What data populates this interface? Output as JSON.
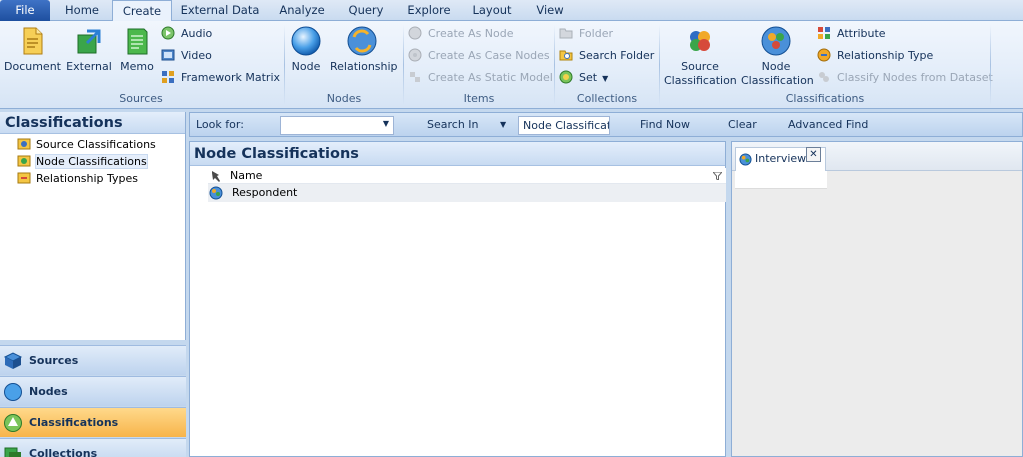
{
  "tabs": {
    "file": "File",
    "home": "Home",
    "create": "Create",
    "external_data": "External Data",
    "analyze": "Analyze",
    "query": "Query",
    "explore": "Explore",
    "layout": "Layout",
    "view": "View"
  },
  "ribbon": {
    "sources": {
      "label": "Sources",
      "document": "Document",
      "external": "External",
      "memo": "Memo",
      "audio": "Audio",
      "video": "Video",
      "framework_matrix": "Framework Matrix"
    },
    "nodes": {
      "label": "Nodes",
      "node": "Node",
      "relationship": "Relationship"
    },
    "items": {
      "label": "Items",
      "create_as_node": "Create As Node",
      "create_as_case_nodes": "Create As Case Nodes",
      "create_as_static_model": "Create As Static Model"
    },
    "collections": {
      "label": "Collections",
      "folder": "Folder",
      "search_folder": "Search Folder",
      "set": "Set"
    },
    "classifications": {
      "label": "Classifications",
      "source_classification_line1": "Source",
      "source_classification_line2": "Classification",
      "node_classification_line1": "Node",
      "node_classification_line2": "Classification",
      "attribute": "Attribute",
      "relationship_type": "Relationship Type",
      "classify_nodes": "Classify Nodes from Dataset"
    }
  },
  "findbar": {
    "look_for_label": "Look for:",
    "look_for_value": "",
    "search_in_label": "Search In",
    "search_in_value": "Node Classificati",
    "find_now": "Find Now",
    "clear": "Clear",
    "advanced_find": "Advanced Find"
  },
  "navigation": {
    "title": "Classifications",
    "tree": [
      {
        "label": "Source Classifications",
        "icon": "source-classification-icon"
      },
      {
        "label": "Node Classifications",
        "icon": "node-classification-icon"
      },
      {
        "label": "Relationship Types",
        "icon": "relationship-type-icon"
      }
    ],
    "buttons": {
      "sources": "Sources",
      "nodes": "Nodes",
      "classifications": "Classifications",
      "collections": "Collections"
    }
  },
  "list": {
    "title": "Node Classifications",
    "column_name": "Name",
    "rows": [
      {
        "name": "Respondent"
      }
    ]
  },
  "detail": {
    "tab_label": "Interview",
    "close_glyph": "✕"
  },
  "colors": {
    "ribbon_bg": "#e3edf9",
    "accent": "#1e4f9f",
    "active_nav": "#f7b44a"
  }
}
